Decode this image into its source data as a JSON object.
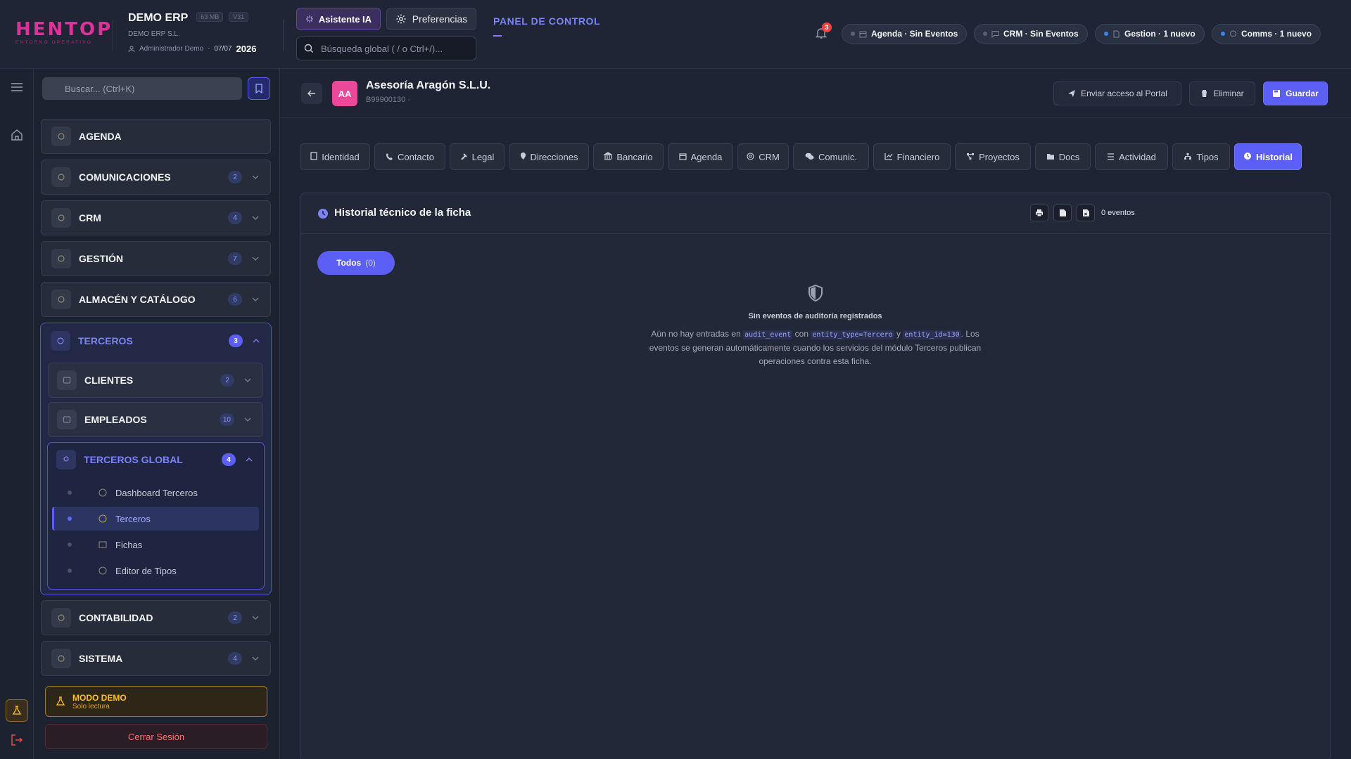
{
  "header": {
    "logo_text": "HENTOP",
    "logo_sub": "ENTORNO OPERATIVO",
    "company_name": "DEMO ERP",
    "tag_size": "63 MB",
    "tag_version": "V31",
    "company_legal": "DEMO ERP S.L.",
    "user": "Administrador Demo",
    "date": "07/07",
    "year": "2026",
    "ia_button": "Asistente IA",
    "pref_button": "Preferencias",
    "search_placeholder": "Búsqueda global ( / o Ctrl+/)...",
    "panel_title": "PANEL DE CONTROL",
    "notifications_count": "3",
    "status_pills": [
      {
        "label": "Agenda · Sin Eventos",
        "dot": "gray"
      },
      {
        "label": "CRM · Sin Eventos",
        "dot": "gray"
      },
      {
        "label": "Gestion · 1 nuevo",
        "dot": "blue"
      },
      {
        "label": "Comms · 1 nuevo",
        "dot": "blue"
      }
    ]
  },
  "sidebar": {
    "search_placeholder": "Buscar... (Ctrl+K)",
    "items": [
      {
        "label": "AGENDA",
        "badge": ""
      },
      {
        "label": "COMUNICACIONES",
        "badge": "2"
      },
      {
        "label": "CRM",
        "badge": "4"
      },
      {
        "label": "GESTIÓN",
        "badge": "7"
      },
      {
        "label": "ALMACÉN Y CATÁLOGO",
        "badge": "6"
      }
    ],
    "terceros": {
      "label": "TERCEROS",
      "badge": "3",
      "children": [
        {
          "label": "CLIENTES",
          "badge": "2"
        },
        {
          "label": "EMPLEADOS",
          "badge": "10"
        }
      ],
      "global": {
        "label": "TERCEROS GLOBAL",
        "badge": "4",
        "leaves": [
          {
            "label": "Dashboard Terceros"
          },
          {
            "label": "Terceros"
          },
          {
            "label": "Fichas"
          },
          {
            "label": "Editor de Tipos"
          }
        ]
      }
    },
    "bottom_items": [
      {
        "label": "CONTABILIDAD",
        "badge": "2"
      },
      {
        "label": "SISTEMA",
        "badge": "4"
      }
    ],
    "demo_title": "MODO DEMO",
    "demo_sub": "Solo lectura",
    "logout": "Cerrar Sesión"
  },
  "entity": {
    "initials": "AA",
    "name": "Asesoría Aragón S.L.U.",
    "id": "B99900130 ·",
    "btn_portal": "Enviar acceso al Portal",
    "btn_delete": "Eliminar",
    "btn_save": "Guardar"
  },
  "tabs": [
    {
      "label": "Identidad",
      "icon": "id-card-icon"
    },
    {
      "label": "Contacto",
      "icon": "phone-icon"
    },
    {
      "label": "Legal",
      "icon": "gavel-icon"
    },
    {
      "label": "Direcciones",
      "icon": "map-pin-icon"
    },
    {
      "label": "Bancario",
      "icon": "bank-icon"
    },
    {
      "label": "Agenda",
      "icon": "calendar-icon"
    },
    {
      "label": "CRM",
      "icon": "target-icon"
    },
    {
      "label": "Comunic.",
      "icon": "chat-icon"
    },
    {
      "label": "Financiero",
      "icon": "chart-line-icon"
    },
    {
      "label": "Proyectos",
      "icon": "project-diagram-icon"
    },
    {
      "label": "Docs",
      "icon": "folder-icon"
    },
    {
      "label": "Actividad",
      "icon": "list-icon"
    },
    {
      "label": "Tipos",
      "icon": "sitemap-icon"
    },
    {
      "label": "Historial",
      "icon": "clock-icon"
    }
  ],
  "history": {
    "title": "Historial técnico de la ficha",
    "events_count": "0 eventos",
    "filter_label": "Todos",
    "filter_count": "(0)",
    "empty_title": "Sin eventos de auditoría registrados",
    "empty_pre": "Aún no hay entradas en ",
    "code1": "audit_event",
    "con": " con ",
    "code2": "entity_type=Tercero",
    "y": " y ",
    "code3": "entity_id=130",
    "empty_post": ". Los eventos se generan automáticamente cuando los servicios del módulo Terceros publican operaciones contra esta ficha."
  },
  "colors": {
    "accent": "#5b5ff5",
    "brand": "#e0309a",
    "avatar": "#ec4899",
    "danger": "#ef4444",
    "warning": "#fbbf24"
  }
}
